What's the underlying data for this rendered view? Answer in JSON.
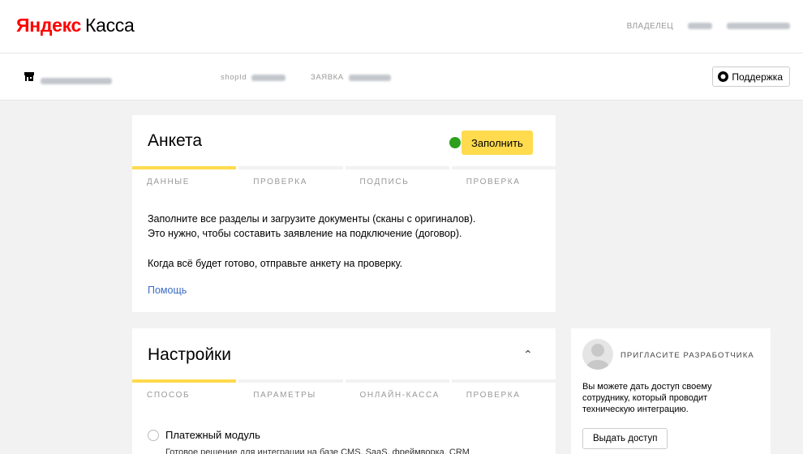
{
  "header": {
    "logo_brand": "Яндекс",
    "logo_product": "Касса",
    "owner_label": "ВЛАДЕЛЕЦ"
  },
  "shopbar": {
    "shop_id_label": "shopId",
    "application_label": "ЗАЯВКА",
    "support_label": "Поддержка"
  },
  "questionnaire": {
    "title": "Анкета",
    "fill_button": "Заполнить",
    "status_color": "#2ca01c",
    "steps": [
      {
        "label": "ДАННЫЕ",
        "active": true
      },
      {
        "label": "ПРОВЕРКА",
        "active": false
      },
      {
        "label": "ПОДПИСЬ",
        "active": false
      },
      {
        "label": "ПРОВЕРКА",
        "active": false
      }
    ],
    "desc_line1": "Заполните все разделы и загрузите документы (сканы с оригиналов).",
    "desc_line2": "Это нужно, чтобы составить заявление на подключение (договор).",
    "desc_line3": "Когда всё будет готово, отправьте анкету на проверку.",
    "help_link": "Помощь"
  },
  "settings": {
    "title": "Настройки",
    "steps": [
      {
        "label": "СПОСОБ",
        "active": true
      },
      {
        "label": "ПАРАМЕТРЫ",
        "active": false
      },
      {
        "label": "ОНЛАЙН-КАССА",
        "active": false
      },
      {
        "label": "ПРОВЕРКА",
        "active": false
      }
    ],
    "option_label": "Платежный модуль",
    "option_desc": "Готовое решение для интеграции на базе CMS, SaaS, фреймворка, CRM"
  },
  "invite": {
    "title": "ПРИГЛАСИТЕ РАЗРАБОТЧИКА",
    "text_line1": "Вы можете дать доступ своему",
    "text_line2": "сотруднику, который проводит",
    "text_line3": "техническую интеграцию.",
    "button": "Выдать доступ"
  },
  "colors": {
    "accent_yellow": "#ffdb4d",
    "link_blue": "#3a6bc8",
    "brand_red": "#ff0000",
    "background": "#f2f2f2"
  }
}
